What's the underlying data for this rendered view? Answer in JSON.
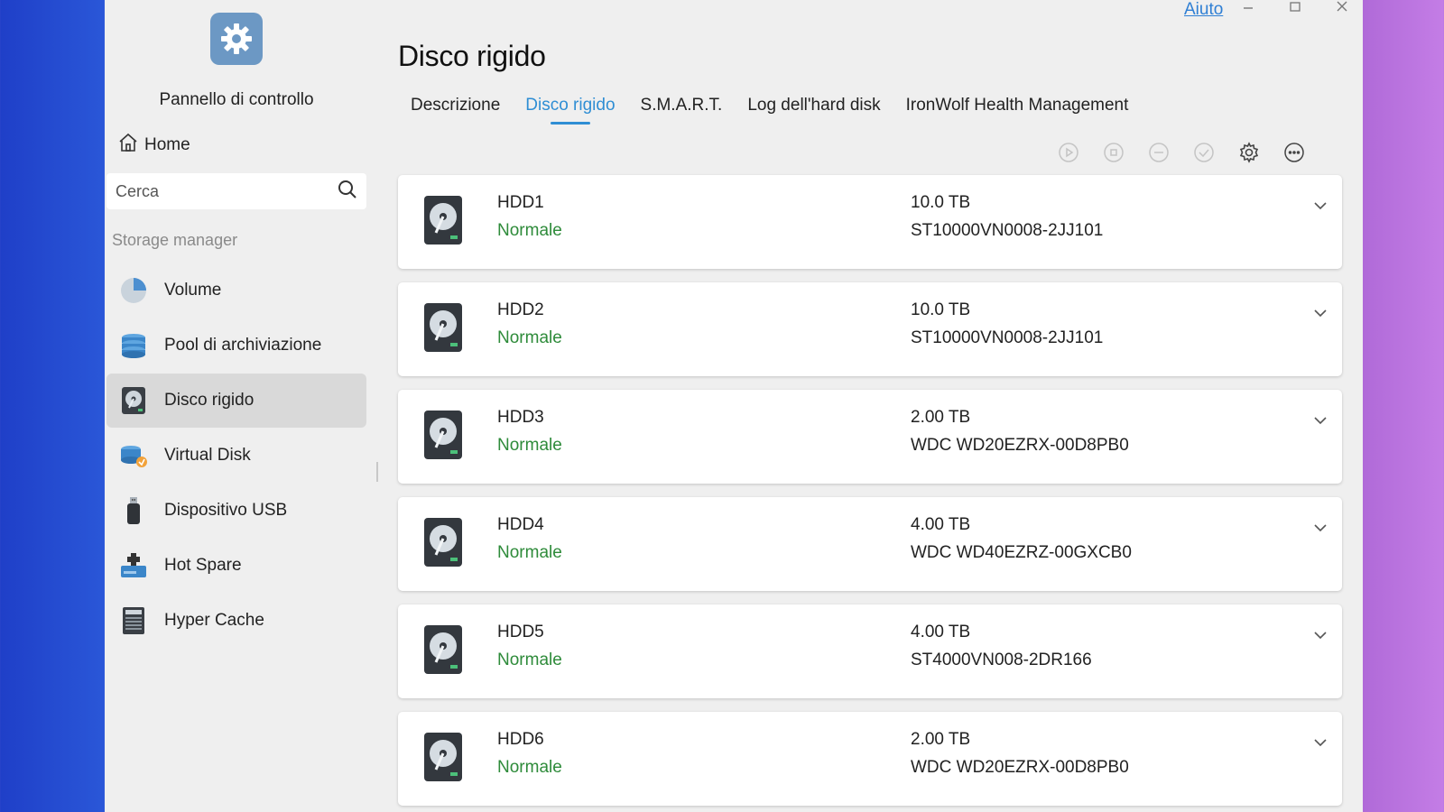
{
  "app": {
    "title": "Pannello di controllo",
    "help": "Aiuto"
  },
  "sidebar": {
    "home": "Home",
    "search_placeholder": "Cerca",
    "section": "Storage manager",
    "items": [
      {
        "label": "Volume",
        "icon": "pie-chart-icon"
      },
      {
        "label": "Pool di archiviazione",
        "icon": "database-stack-icon"
      },
      {
        "label": "Disco rigido",
        "icon": "hard-disk-icon",
        "active": true
      },
      {
        "label": "Virtual Disk",
        "icon": "virtual-disk-icon"
      },
      {
        "label": "Dispositivo USB",
        "icon": "usb-drive-icon"
      },
      {
        "label": "Hot Spare",
        "icon": "hot-spare-icon"
      },
      {
        "label": "Hyper Cache",
        "icon": "ssd-cache-icon"
      }
    ]
  },
  "main": {
    "title": "Disco rigido",
    "tabs": [
      {
        "label": "Descrizione"
      },
      {
        "label": "Disco rigido",
        "active": true
      },
      {
        "label": "S.M.A.R.T."
      },
      {
        "label": "Log dell'hard disk"
      },
      {
        "label": "IronWolf Health Management"
      }
    ],
    "toolbar": [
      "play-icon",
      "stop-icon",
      "minus-circle-icon",
      "check-circle-icon",
      "gear-icon",
      "more-icon"
    ],
    "disks": [
      {
        "name": "HDD1",
        "status": "Normale",
        "size": "10.0 TB",
        "model": "ST10000VN0008-2JJ101"
      },
      {
        "name": "HDD2",
        "status": "Normale",
        "size": "10.0 TB",
        "model": "ST10000VN0008-2JJ101"
      },
      {
        "name": "HDD3",
        "status": "Normale",
        "size": "2.00 TB",
        "model": "WDC WD20EZRX-00D8PB0"
      },
      {
        "name": "HDD4",
        "status": "Normale",
        "size": "4.00 TB",
        "model": "WDC WD40EZRZ-00GXCB0"
      },
      {
        "name": "HDD5",
        "status": "Normale",
        "size": "4.00 TB",
        "model": "ST4000VN008-2DR166"
      },
      {
        "name": "HDD6",
        "status": "Normale",
        "size": "2.00 TB",
        "model": "WDC WD20EZRX-00D8PB0"
      }
    ]
  },
  "colors": {
    "accent": "#2f8ed4",
    "status_ok": "#2e8b3a",
    "active_bg": "#d9d9d9"
  }
}
